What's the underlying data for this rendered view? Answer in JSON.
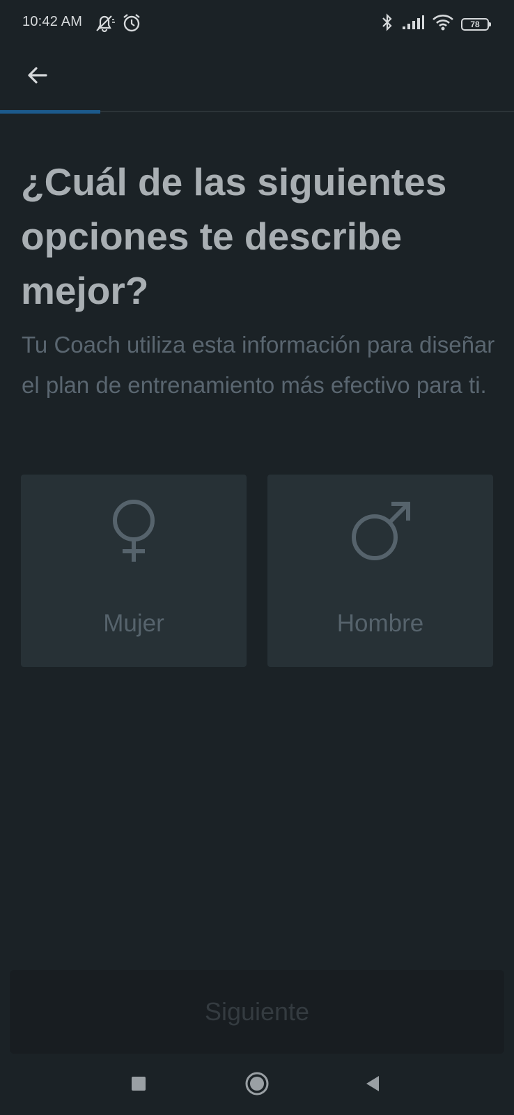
{
  "status_bar": {
    "time": "10:42 AM",
    "battery": "78",
    "left_icons": [
      "muted-bell-icon",
      "alarm-icon"
    ],
    "right_icons": [
      "bluetooth-icon",
      "signal-icon",
      "wifi-icon",
      "battery-icon"
    ]
  },
  "header": {
    "back_icon": "arrow-left-icon",
    "progress": 0.195,
    "progress_color": "#1c5a8c"
  },
  "main": {
    "title": "¿Cuál de las siguientes opciones te describe mejor?",
    "subtitle": "Tu Coach utiliza esta información para diseñar el plan de entrenamiento más efectivo para ti.",
    "options": [
      {
        "label": "Mujer",
        "icon": "female-symbol-icon"
      },
      {
        "label": "Hombre",
        "icon": "male-symbol-icon"
      }
    ]
  },
  "footer": {
    "next_label": "Siguiente"
  },
  "nav_bar": {
    "icons": [
      "recents-square-icon",
      "home-circle-icon",
      "back-triangle-icon"
    ]
  },
  "colors": {
    "background": "#1b2226",
    "card": "#273136",
    "accent": "#1c5a8c"
  }
}
